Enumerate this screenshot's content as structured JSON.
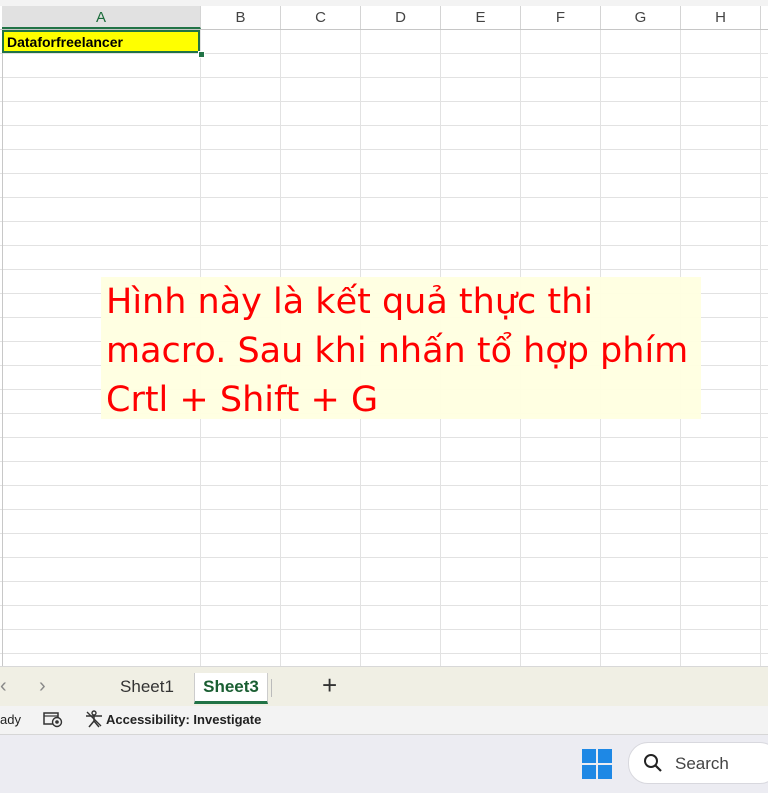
{
  "columns": [
    "A",
    "B",
    "C",
    "D",
    "E",
    "F",
    "G",
    "H"
  ],
  "cell_a1": "Dataforfreelancer",
  "cell_a1_fill": "#ffff00",
  "note": {
    "text": "Hình này là kết quả thực thi\nmacro. Sau khi nhấn tổ hợp phím\nCrtl + Shift + G",
    "color": "#ff0000",
    "background": "#ffffe0"
  },
  "sheet_tabs": [
    {
      "label": "Sheet1",
      "active": false
    },
    {
      "label": "Sheet3",
      "active": true
    }
  ],
  "add_sheet_icon": "plus-icon",
  "nav_icons": [
    "chevron-left-icon",
    "chevron-right-icon"
  ],
  "status": {
    "ready": "ady",
    "accessibility": "Accessibility: Investigate"
  },
  "taskbar": {
    "search_label": "Search"
  },
  "accent_color": "#217346"
}
